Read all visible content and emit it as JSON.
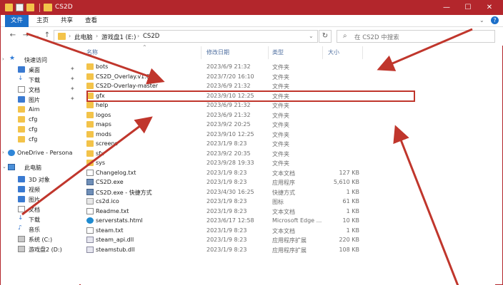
{
  "window": {
    "title": "CS2D",
    "minimize": "—",
    "maximize": "☐",
    "close": "✕"
  },
  "ribbon": {
    "tabs": [
      {
        "label": "文件",
        "active": true
      },
      {
        "label": "主页",
        "active": false
      },
      {
        "label": "共享",
        "active": false
      },
      {
        "label": "查看",
        "active": false
      }
    ]
  },
  "address": {
    "crumbs": [
      "此电脑",
      "游戏盘1 (E:)",
      "CS2D"
    ],
    "search_placeholder": "在 CS2D 中搜索"
  },
  "nav": {
    "items": [
      {
        "label": "快速访问",
        "icon": "star-icon",
        "pinned": false
      },
      {
        "label": "桌面",
        "icon": "desktop-icon",
        "pinned": true
      },
      {
        "label": "下载",
        "icon": "download-icon",
        "pinned": true
      },
      {
        "label": "文档",
        "icon": "documents-icon",
        "pinned": true
      },
      {
        "label": "图片",
        "icon": "pictures-icon",
        "pinned": true
      },
      {
        "label": "Aim",
        "icon": "folder-icon",
        "pinned": false
      },
      {
        "label": "cfg",
        "icon": "folder-icon",
        "pinned": false
      },
      {
        "label": "cfg",
        "icon": "folder-icon",
        "pinned": false
      },
      {
        "label": "cfg",
        "icon": "folder-icon",
        "pinned": false
      },
      {
        "label": "OneDrive - Persona",
        "icon": "onedrive-icon",
        "pinned": false
      },
      {
        "label": "此电脑",
        "icon": "this-pc-icon",
        "pinned": false
      },
      {
        "label": "3D 对象",
        "icon": "3d-objects-icon",
        "pinned": false
      },
      {
        "label": "视频",
        "icon": "videos-icon",
        "pinned": false
      },
      {
        "label": "图片",
        "icon": "pictures-icon",
        "pinned": false
      },
      {
        "label": "文档",
        "icon": "documents-icon",
        "pinned": false
      },
      {
        "label": "下载",
        "icon": "download-icon",
        "pinned": false
      },
      {
        "label": "音乐",
        "icon": "music-icon",
        "pinned": false
      },
      {
        "label": "系统 (C:)",
        "icon": "drive-icon",
        "pinned": false
      },
      {
        "label": "游戏盘2 (D:)",
        "icon": "drive-icon",
        "pinned": false
      }
    ]
  },
  "columns": {
    "name": "名称",
    "date": "修改日期",
    "type": "类型",
    "size": "大小"
  },
  "files": [
    {
      "name": "bots",
      "date": "2023/6/9 21:32",
      "type": "文件夹",
      "size": "",
      "icon": "folder"
    },
    {
      "name": "CS2D_Overlay.v1.0",
      "date": "2023/7/20 16:10",
      "type": "文件夹",
      "size": "",
      "icon": "folder"
    },
    {
      "name": "CS2D-Overlay-master",
      "date": "2023/6/9 21:32",
      "type": "文件夹",
      "size": "",
      "icon": "folder"
    },
    {
      "name": "gfx",
      "date": "2023/9/10 12:25",
      "type": "文件夹",
      "size": "",
      "icon": "folder"
    },
    {
      "name": "help",
      "date": "2023/6/9 21:32",
      "type": "文件夹",
      "size": "",
      "icon": "folder"
    },
    {
      "name": "logos",
      "date": "2023/6/9 21:32",
      "type": "文件夹",
      "size": "",
      "icon": "folder"
    },
    {
      "name": "maps",
      "date": "2023/9/2 20:25",
      "type": "文件夹",
      "size": "",
      "icon": "folder"
    },
    {
      "name": "mods",
      "date": "2023/9/10 12:25",
      "type": "文件夹",
      "size": "",
      "icon": "folder"
    },
    {
      "name": "screens",
      "date": "2023/1/9 8:23",
      "type": "文件夹",
      "size": "",
      "icon": "folder"
    },
    {
      "name": "sfx",
      "date": "2023/9/2 20:35",
      "type": "文件夹",
      "size": "",
      "icon": "folder"
    },
    {
      "name": "sys",
      "date": "2023/9/28 19:33",
      "type": "文件夹",
      "size": "",
      "icon": "folder"
    },
    {
      "name": "Changelog.txt",
      "date": "2023/1/9 8:23",
      "type": "文本文档",
      "size": "127 KB",
      "icon": "txt"
    },
    {
      "name": "CS2D.exe",
      "date": "2023/1/9 8:23",
      "type": "应用程序",
      "size": "5,610 KB",
      "icon": "exe"
    },
    {
      "name": "CS2D.exe - 快捷方式",
      "date": "2023/4/30 16:25",
      "type": "快捷方式",
      "size": "1 KB",
      "icon": "exe"
    },
    {
      "name": "cs2d.ico",
      "date": "2023/1/9 8:23",
      "type": "图标",
      "size": "61 KB",
      "icon": "ico"
    },
    {
      "name": "Readme.txt",
      "date": "2023/1/9 8:23",
      "type": "文本文档",
      "size": "1 KB",
      "icon": "txt"
    },
    {
      "name": "serverstats.html",
      "date": "2023/6/17 12:58",
      "type": "Microsoft Edge ...",
      "size": "10 KB",
      "icon": "edge"
    },
    {
      "name": "steam.txt",
      "date": "2023/1/9 8:23",
      "type": "文本文档",
      "size": "1 KB",
      "icon": "txt"
    },
    {
      "name": "steam_api.dll",
      "date": "2023/1/9 8:23",
      "type": "应用程序扩展",
      "size": "220 KB",
      "icon": "dll"
    },
    {
      "name": "steamstub.dll",
      "date": "2023/1/9 8:23",
      "type": "应用程序扩展",
      "size": "108 KB",
      "icon": "dll"
    }
  ],
  "colors": {
    "titlebar": "#b3262c",
    "active_tab": "#1b6fc9",
    "annotation": "#c0362c",
    "folder": "#f3c34a"
  }
}
